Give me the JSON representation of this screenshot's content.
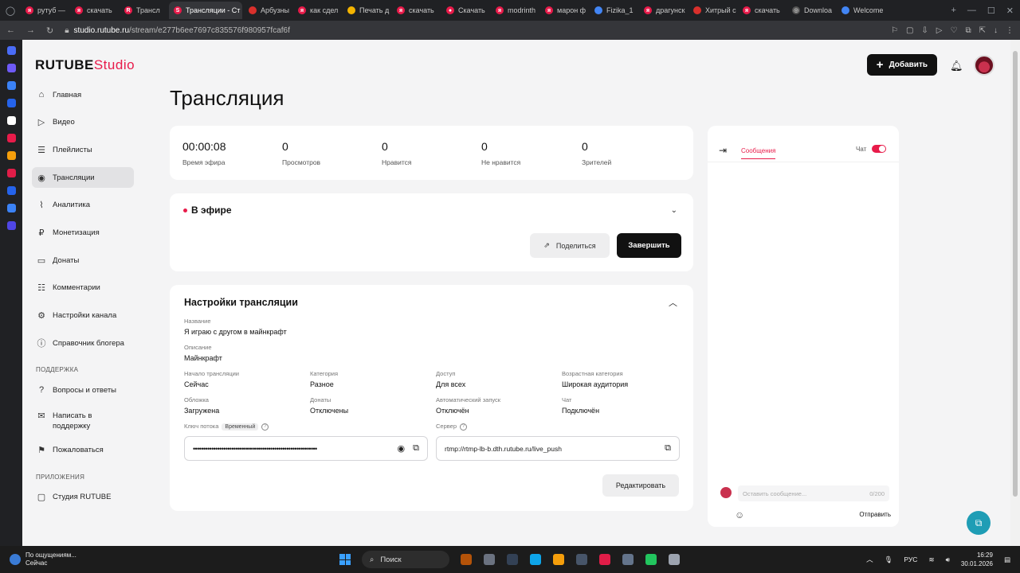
{
  "browser": {
    "tabs": [
      {
        "label": "рутуб —",
        "color": "#e81b4a",
        "glyph": "я"
      },
      {
        "label": "скачать",
        "color": "#e81b4a",
        "glyph": "я"
      },
      {
        "label": "Трансл",
        "color": "#e81b4a",
        "glyph": "R"
      },
      {
        "label": "Трансляции - Ст",
        "color": "#e81b4a",
        "glyph": "S",
        "active": true
      },
      {
        "label": "Арбузны",
        "color": "#d9302c",
        "glyph": ""
      },
      {
        "label": "как сдел",
        "color": "#e81b4a",
        "glyph": "я"
      },
      {
        "label": "Печать д",
        "color": "#f4b400",
        "glyph": ""
      },
      {
        "label": "скачать",
        "color": "#e81b4a",
        "glyph": "я"
      },
      {
        "label": "Скачать",
        "color": "#e81b4a",
        "glyph": "●"
      },
      {
        "label": "modrinth",
        "color": "#e81b4a",
        "glyph": "я"
      },
      {
        "label": "марон ф",
        "color": "#e81b4a",
        "glyph": "я"
      },
      {
        "label": "Fizika_1",
        "color": "#4285f4",
        "glyph": ""
      },
      {
        "label": "драгунск",
        "color": "#e81b4a",
        "glyph": "я"
      },
      {
        "label": "Хитрый с",
        "color": "#d9302c",
        "glyph": ""
      },
      {
        "label": "скачать",
        "color": "#e81b4a",
        "glyph": "я"
      },
      {
        "label": "Downloa",
        "color": "#555555",
        "glyph": "◎"
      },
      {
        "label": "Welcome",
        "color": "#4285f4",
        "glyph": ""
      }
    ],
    "url_host": "studio.rutube.ru",
    "url_path": "/stream/e277b6ee7697c835576f980957fcaf6f"
  },
  "header": {
    "brand": "RUTUBE",
    "brand_suffix": "Studio",
    "add_label": "Добавить"
  },
  "sidebar": {
    "items": [
      {
        "label": "Главная",
        "icon": "⌂"
      },
      {
        "label": "Видео",
        "icon": "▷"
      },
      {
        "label": "Плейлисты",
        "icon": "☰"
      },
      {
        "label": "Трансляции",
        "icon": "◉",
        "active": true
      },
      {
        "label": "Аналитика",
        "icon": "⌇"
      },
      {
        "label": "Монетизация",
        "icon": "₽"
      },
      {
        "label": "Донаты",
        "icon": "▭"
      },
      {
        "label": "Комментарии",
        "icon": "☷"
      },
      {
        "label": "Настройки канала",
        "icon": "⚙"
      },
      {
        "label": "Справочник блогера",
        "icon": "ⓘ"
      }
    ],
    "support_title": "ПОДДЕРЖКА",
    "support_items": [
      {
        "label": "Вопросы и ответы",
        "icon": "?"
      },
      {
        "label": "Написать в поддержку",
        "icon": "✉"
      },
      {
        "label": "Пожаловаться",
        "icon": "⚑"
      }
    ],
    "apps_title": "ПРИЛОЖЕНИЯ",
    "apps_items": [
      {
        "label": "Студия RUTUBE",
        "icon": "▢"
      }
    ]
  },
  "main": {
    "title": "Трансляция",
    "stats": [
      {
        "value": "00:00:08",
        "caption": "Время эфира"
      },
      {
        "value": "0",
        "caption": "Просмотров"
      },
      {
        "value": "0",
        "caption": "Нравится"
      },
      {
        "value": "0",
        "caption": "Не нравится"
      },
      {
        "value": "0",
        "caption": "Зрителей"
      }
    ],
    "live": {
      "status": "В эфире",
      "share_label": "Поделиться",
      "end_label": "Завершить"
    },
    "settings": {
      "title": "Настройки трансляции",
      "name_label": "Название",
      "name_value": "Я играю с другом в майнкрафт",
      "desc_label": "Описание",
      "desc_value": "Майнкрафт",
      "start_label": "Начало трансляции",
      "start_value": "Сейчас",
      "category_label": "Категория",
      "category_value": "Разное",
      "access_label": "Доступ",
      "access_value": "Для всех",
      "age_label": "Возрастная категория",
      "age_value": "Широкая аудитория",
      "cover_label": "Обложка",
      "cover_value": "Загружена",
      "donations_label": "Донаты",
      "donations_value": "Отключены",
      "autostart_label": "Автоматический запуск",
      "autostart_value": "Отключён",
      "chat_label": "Чат",
      "chat_value": "Подключён",
      "key_label": "Ключ потока",
      "key_tag": "Временный",
      "key_value": "•••••••••••••••••••••••••••••••••••••••••••••••••••••••••••••",
      "server_label": "Сервер",
      "server_value": "rtmp://rtmp-lb-b.dth.rutube.ru/live_push",
      "edit_label": "Редактировать"
    }
  },
  "chat": {
    "tab_messages": "Сообщения",
    "chat_toggle_label": "Чат",
    "chat_enabled": true,
    "input_placeholder": "Оставить сообщение...",
    "char_count": "0/200",
    "send_label": "Отправить"
  },
  "taskbar": {
    "weather_line1": "По ощущениям...",
    "weather_line2": "Сейчас",
    "search_label": "Поиск",
    "lang": "РУС",
    "time": "16:29",
    "date": "30.01.2026"
  },
  "colors": {
    "accent": "#e81b4a",
    "fab": "#1f9db5"
  }
}
